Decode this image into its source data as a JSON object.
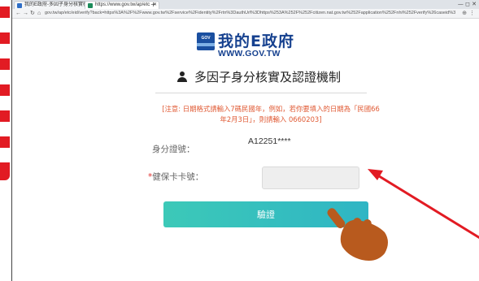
{
  "browser": {
    "tabs": [
      {
        "label": "我的E政府-多因子身分核實機制"
      },
      {
        "label": "https://www.gov.tw/ap/etc"
      }
    ],
    "new_tab": "+",
    "window_controls": "—  ◻  ✕",
    "url": "gov.tw/ap/etc/eid/verify?back=https%3A%2F%2Fwww.gov.tw%2Fservice%2Fidentity%2Frtn%3DauthUrl%3Dhttps%253A%252F%252Fcitizen.nat.gov.tw%252Fapplication%252Fnhi%252Fverify%26caseid%3D"
  },
  "page": {
    "logo": {
      "badge_text": "GOV",
      "title": "我的E政府",
      "url_text": "WWW.GOV.TW"
    },
    "heading": "多因子身分核實及認證機制",
    "notice": "[注意: 日期格式請輸入7碼民國年，例如，若你要填入的日期為「民國66年2月3日」，則請輸入 0660203]",
    "id_label": "身分證號：",
    "id_value": "A12251****",
    "card_required_mark": "*",
    "card_label": "健保卡卡號：",
    "card_value": "",
    "card_placeholder": "",
    "verify_button": "驗證"
  },
  "annotation": {
    "arrow_color": "#e21b23",
    "hand_color": "#b85a1e",
    "hand_icon": "pointing-hand-icon"
  },
  "colors": {
    "brand_blue": "#16418f",
    "notice_orange": "#e05a34",
    "button_teal": "#35bfc0",
    "left_tab_red": "#e21b23"
  }
}
